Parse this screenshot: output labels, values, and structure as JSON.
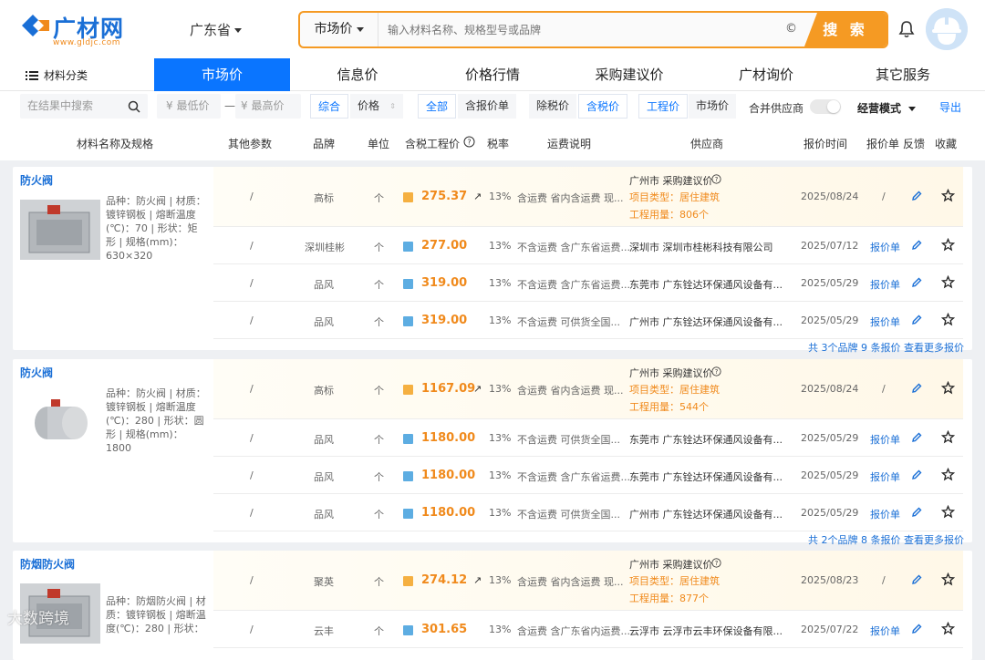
{
  "logo": {
    "name": "广材网",
    "url": "www.gldjc.com"
  },
  "header": {
    "region": "广东省",
    "search_type": "市场价",
    "search_placeholder": "输入材料名称、规格型号或品牌",
    "search_button": "搜 索",
    "copyright_symbol": "©"
  },
  "nav": {
    "category": "材料分类",
    "tabs": [
      "市场价",
      "信息价",
      "价格行情",
      "采购建议价",
      "广材询价",
      "其它服务"
    ]
  },
  "filters": {
    "search_in_results": "在结果中搜索",
    "min_price": "¥ 最低价",
    "dash": "—",
    "max_price": "¥ 最高价",
    "sort_all": "综合",
    "sort_price": "价格",
    "all": "全部",
    "with_quote": "含报价单",
    "ex_tax": "除税价",
    "inc_tax": "含税价",
    "engineering_price": "工程价",
    "market_price": "市场价",
    "merge_supplier": "合并供应商",
    "mode": "经营模式",
    "export": "导出"
  },
  "table_headers": [
    "材料名称及规格",
    "其他参数",
    "品牌",
    "单位",
    "含税工程价",
    "税率",
    "运费说明",
    "供应商",
    "报价时间",
    "报价单",
    "反馈",
    "收藏"
  ],
  "products": [
    {
      "title": "防火阀",
      "desc": "品种：防火阀 | 材质：镀锌钢板 | 熔断温度(℃)：70 | 形状：矩形 | 规格(mm)：630×320",
      "rows": [
        {
          "param": "/",
          "brand": "高标",
          "unit": "个",
          "price": "275.37",
          "trend": "↗",
          "tax": "13%",
          "freight": "含运费 省内含运费 现...",
          "supplier": "广州市 采购建议价",
          "type_label": "项目类型：居住建筑",
          "usage_label": "工程用量：806个",
          "date": "2025/08/24",
          "quote": "/"
        },
        {
          "param": "/",
          "brand": "深圳桂彬",
          "unit": "个",
          "price": "277.00",
          "trend": "",
          "tax": "13%",
          "freight": "不含运费 含广东省运费...",
          "supplier": "深圳市 深圳市桂彬科技有限公司",
          "type_label": "",
          "usage_label": "",
          "date": "2025/07/12",
          "quote": "报价单"
        },
        {
          "param": "/",
          "brand": "品风",
          "unit": "个",
          "price": "319.00",
          "trend": "",
          "tax": "13%",
          "freight": "不含运费 含广东省运费...",
          "supplier": "东莞市 广东铨达环保通风设备有...",
          "type_label": "",
          "usage_label": "",
          "date": "2025/05/29",
          "quote": "报价单"
        },
        {
          "param": "/",
          "brand": "品风",
          "unit": "个",
          "price": "319.00",
          "trend": "",
          "tax": "13%",
          "freight": "不含运费 可供货全国...",
          "supplier": "广州市 广东铨达环保通风设备有...",
          "type_label": "",
          "usage_label": "",
          "date": "2025/05/29",
          "quote": "报价单"
        }
      ],
      "more": "共 3个品牌 9 条报价 查看更多报价"
    },
    {
      "title": "防火阀",
      "desc": "品种：防火阀 | 材质：镀锌钢板 | 熔断温度(℃)：280 | 形状：圆形 | 规格(mm)：1800",
      "rows": [
        {
          "param": "/",
          "brand": "高标",
          "unit": "个",
          "price": "1167.09",
          "trend": "↗",
          "tax": "13%",
          "freight": "含运费 省内含运费 现...",
          "supplier": "广州市 采购建议价",
          "type_label": "项目类型：居住建筑",
          "usage_label": "工程用量：544个",
          "date": "2025/08/24",
          "quote": "/"
        },
        {
          "param": "/",
          "brand": "品风",
          "unit": "个",
          "price": "1180.00",
          "trend": "",
          "tax": "13%",
          "freight": "不含运费 可供货全国...",
          "supplier": "东莞市 广东铨达环保通风设备有...",
          "type_label": "",
          "usage_label": "",
          "date": "2025/05/29",
          "quote": "报价单"
        },
        {
          "param": "/",
          "brand": "品风",
          "unit": "个",
          "price": "1180.00",
          "trend": "",
          "tax": "13%",
          "freight": "不含运费 含广东省运费...",
          "supplier": "东莞市 广东铨达环保通风设备有...",
          "type_label": "",
          "usage_label": "",
          "date": "2025/05/29",
          "quote": "报价单"
        },
        {
          "param": "/",
          "brand": "品风",
          "unit": "个",
          "price": "1180.00",
          "trend": "",
          "tax": "13%",
          "freight": "不含运费 可供货全国...",
          "supplier": "广州市 广东铨达环保通风设备有...",
          "type_label": "",
          "usage_label": "",
          "date": "2025/05/29",
          "quote": "报价单"
        }
      ],
      "more": "共 2个品牌 8 条报价 查看更多报价"
    },
    {
      "title": "防烟防火阀",
      "desc": "品种：防烟防火阀 | 材质：镀锌钢板 | 熔断温度(℃)：280 | 形状：",
      "rows": [
        {
          "param": "/",
          "brand": "聚英",
          "unit": "个",
          "price": "274.12",
          "trend": "↗",
          "tax": "13%",
          "freight": "含运费 省内含运费 现...",
          "supplier": "广州市 采购建议价",
          "type_label": "项目类型：居住建筑",
          "usage_label": "工程用量：877个",
          "date": "2025/08/23",
          "quote": "/"
        },
        {
          "param": "/",
          "brand": "云丰",
          "unit": "个",
          "price": "301.65",
          "trend": "",
          "tax": "13%",
          "freight": "含运费 含广东省内运费...",
          "supplier": "云浮市 云浮市云丰环保设备有限...",
          "type_label": "",
          "usage_label": "",
          "date": "2025/07/22",
          "quote": "报价单"
        }
      ],
      "more": ""
    }
  ],
  "watermark": "大数跨境",
  "colors": {
    "accent": "#0a75ff",
    "orange": "#f59a23",
    "price": "#f08a1c",
    "link": "#1a6fd6"
  }
}
